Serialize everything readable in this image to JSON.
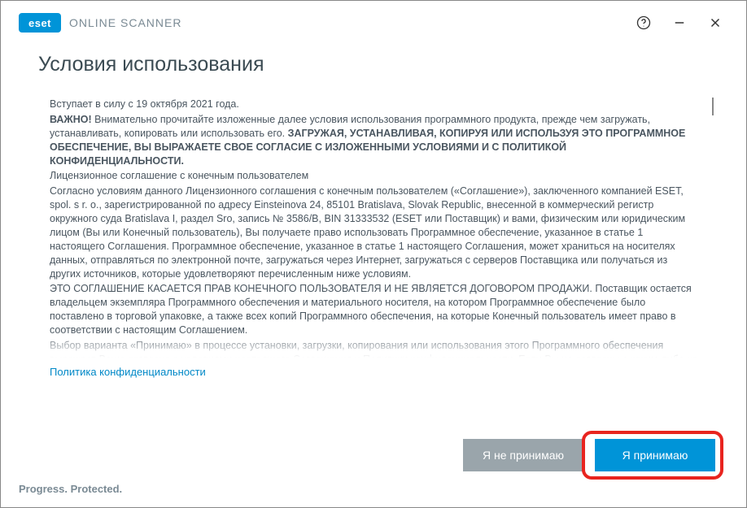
{
  "header": {
    "logo_text": "eset",
    "app_title": "ONLINE SCANNER"
  },
  "page": {
    "title": "Условия использования"
  },
  "terms": {
    "effective": "Вступает в силу с 19 октября 2021 года.",
    "important_label": "ВАЖНО!",
    "important_lead": " Внимательно прочитайте изложенные далее условия использования программного продукта, прежде чем загружать, устанавливать, копировать или использовать его. ",
    "important_bold": "ЗАГРУЖАЯ, УСТАНАВЛИВАЯ, КОПИРУЯ ИЛИ ИСПОЛЬЗУЯ ЭТО ПРОГРАММНОЕ ОБЕСПЕЧЕНИЕ, ВЫ ВЫРАЖАЕТЕ СВОЕ СОГЛАСИЕ С ИЗЛОЖЕННЫМИ УСЛОВИЯМИ И С ПОЛИТИКОЙ КОНФИДЕНЦИАЛЬНОСТИ.",
    "eula_heading": "Лицензионное соглашение с конечным пользователем",
    "para1": "Согласно условиям данного Лицензионного соглашения с конечным пользователем («Соглашение»), заключенного компанией ESET, spol. s r. o., зарегистрированной по адресу Einsteinova 24, 85101 Bratislava, Slovak Republic, внесенной в коммерческий регистр окружного суда Bratislava I, раздел Sro, запись № 3586/B, BIN 31333532 (ESET или Поставщик) и вами, физическим или юридическим лицом (Вы или Конечный пользователь), Вы получаете право использовать Программное обеспечение, указанное в статье 1 настоящего Соглашения. Программное обеспечение, указанное в статье 1 настоящего Соглашения, может храниться на носителях данных, отправляться по электронной почте, загружаться через Интернет, загружаться с серверов Поставщика или получаться из других источников, которые удовлетворяют перечисленным ниже условиям.",
    "para2": "ЭТО СОГЛАШЕНИЕ КАСАЕТСЯ ПРАВ КОНЕЧНОГО ПОЛЬЗОВАТЕЛЯ И НЕ ЯВЛЯЕТСЯ ДОГОВОРОМ ПРОДАЖИ. Поставщик остается владельцем экземпляра Программного обеспечения и материального носителя, на котором Программное обеспечение было поставлено в торговой упаковке, а также всех копий Программного обеспечения, на которые Конечный пользователь имеет право в соответствии с настоящим Соглашением.",
    "para3": "Выбор варианта «Принимаю» в процессе установки, загрузки, копирования или использования этого Программного обеспечения выражает Ваше согласие с условиями настоящего Соглашения и Политики конфиденциальности. Если Вы не согласны с каким-либо из условий настоящего Соглашения или Политики конфиденциальности, немедленно выберите вариант отмены, отмените установку или загрузку, уничтожьте или верните Программное обеспечение, установочные носители, сопроводительную документацию, а также квитанцию об оплате Поставщику или в организацию, в которой было приобретено Программное обеспечение."
  },
  "links": {
    "privacy": "Политика конфиденциальности"
  },
  "buttons": {
    "decline": "Я не принимаю",
    "accept": "Я принимаю"
  },
  "footer": {
    "tagline": "Progress. Protected."
  }
}
